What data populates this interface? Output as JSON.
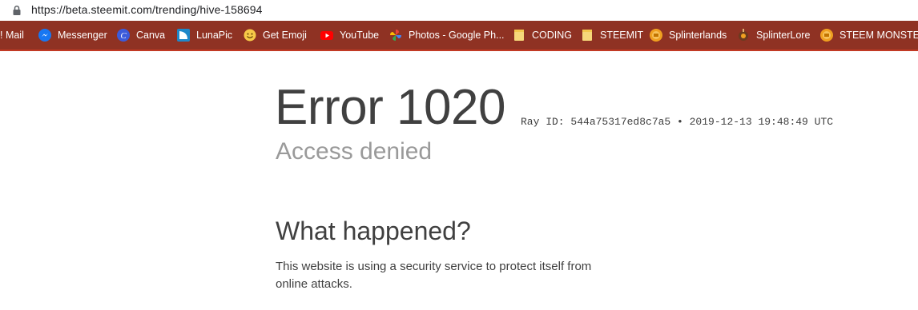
{
  "browser": {
    "url": "https://beta.steemit.com/trending/hive-158694",
    "url_icon": "lock-icon"
  },
  "bookmarks": [
    {
      "label": "! Mail",
      "icon": "mail-icon"
    },
    {
      "label": "Messenger",
      "icon": "messenger-icon",
      "color": "#1877f2"
    },
    {
      "label": "Canva",
      "icon": "canva-icon",
      "color": "#3b5bdb"
    },
    {
      "label": "LunaPic",
      "icon": "lunapic-icon",
      "color": "#1e88c9"
    },
    {
      "label": "Get Emoji",
      "icon": "emoji-icon",
      "color": "#f7c948"
    },
    {
      "label": "YouTube",
      "icon": "youtube-icon",
      "color": "#ff0000"
    },
    {
      "label": "Photos - Google Ph...",
      "icon": "pinwheel-icon"
    },
    {
      "label": "CODING",
      "icon": "folder-icon",
      "color": "#f6d77a"
    },
    {
      "label": "STEEMIT",
      "icon": "folder-icon",
      "color": "#f6d77a"
    },
    {
      "label": "Splinterlands",
      "icon": "splinterlands-icon",
      "color": "#f0a020"
    },
    {
      "label": "SplinterLore",
      "icon": "splinterlore-icon",
      "color": "#6b3a1f"
    },
    {
      "label": "STEEM MONSTERS",
      "icon": "steem-monsters-icon",
      "color": "#f0a020"
    }
  ],
  "error": {
    "title": "Error 1020",
    "ray": "Ray ID: 544a75317ed8c7a5 • 2019-12-13 19:48:49 UTC",
    "subtitle": "Access denied",
    "what_heading": "What happened?",
    "what_text": "This website is using a security service to protect itself from online attacks."
  }
}
